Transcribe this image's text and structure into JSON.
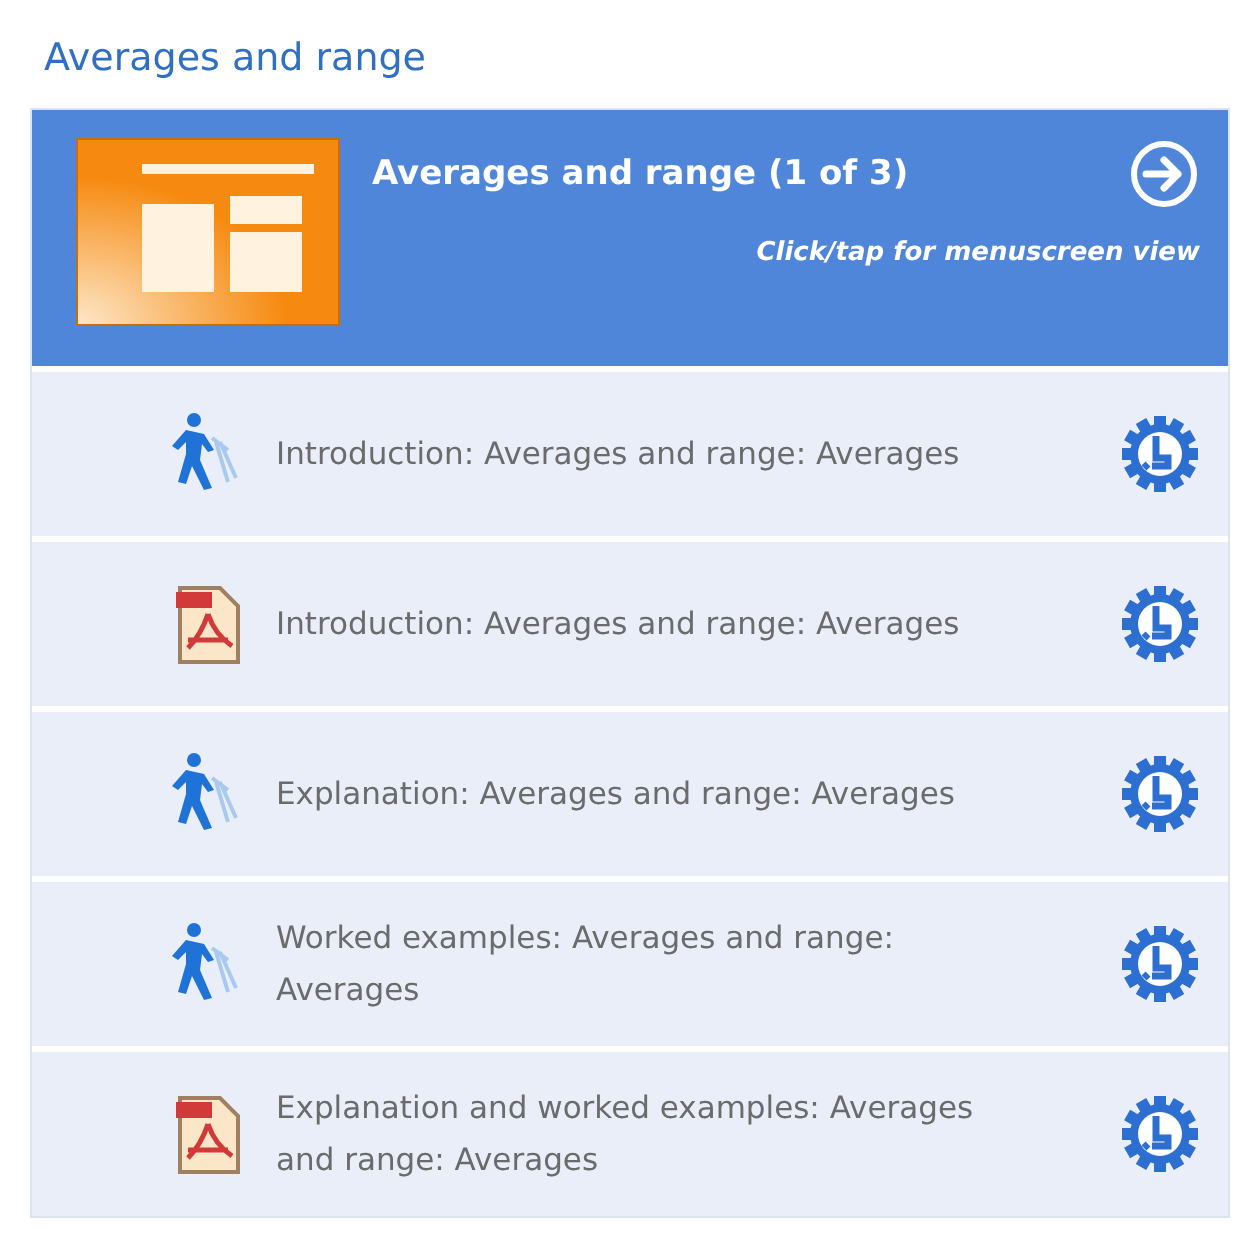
{
  "section_title": "Averages and range",
  "header": {
    "title": "Averages and range (1 of 3)",
    "subtitle": "Click/tap for menuscreen view"
  },
  "items": [
    {
      "kind": "animation",
      "label": "Introduction: Averages and range: Averages"
    },
    {
      "kind": "pdf",
      "label": "Introduction: Averages and range: Averages"
    },
    {
      "kind": "animation",
      "label": "Explanation: Averages and range: Averages"
    },
    {
      "kind": "animation",
      "label": "Worked examples: Averages and range: Averages"
    },
    {
      "kind": "pdf",
      "label": "Explanation and worked examples: Averages and range: Averages"
    }
  ]
}
